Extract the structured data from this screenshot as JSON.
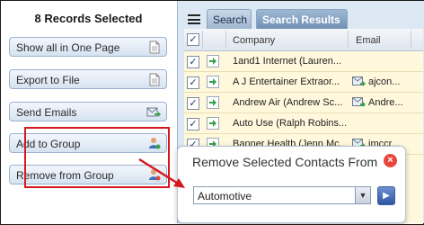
{
  "left_panel": {
    "title": "8 Records Selected",
    "buttons": [
      {
        "label": "Show all in One Page",
        "icon": "page-icon"
      },
      {
        "label": "Export to File",
        "icon": "file-icon"
      },
      {
        "label": "Send Emails",
        "icon": "email-send-icon"
      },
      {
        "label": "Add to Group",
        "icon": "user-add-icon"
      },
      {
        "label": "Remove from Group",
        "icon": "user-remove-icon"
      }
    ]
  },
  "tabs": {
    "search": "Search",
    "results": "Search Results"
  },
  "grid": {
    "columns": [
      "Company",
      "Email"
    ],
    "rows": [
      {
        "company": "1and1 Internet (Lauren...",
        "email": ""
      },
      {
        "company": "A J Entertainer Extraor...",
        "email": "ajcon..."
      },
      {
        "company": "Andrew Air (Andrew Sc...",
        "email": "Andre..."
      },
      {
        "company": "Auto Use (Ralph Robins...",
        "email": ""
      },
      {
        "company": "Banner Health (Jenn Mc...",
        "email": "jmccr..."
      }
    ]
  },
  "popup": {
    "title": "Remove Selected Contacts From",
    "close_symbol": "×",
    "selected_value": "Automotive",
    "dropdown_symbol": "▼",
    "go_symbol": "▶"
  },
  "colors": {
    "highlight": "#d4181e",
    "tab_active": "#6f8fb3",
    "grid_row_bg": "#fff8dc"
  }
}
